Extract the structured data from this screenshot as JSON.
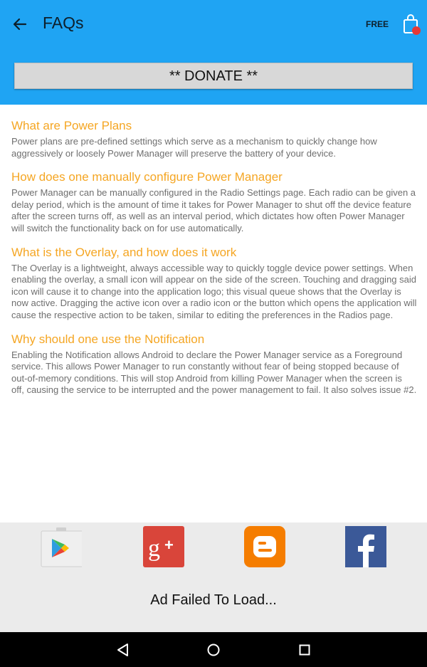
{
  "appbar": {
    "title": "FAQs",
    "free_label": "FREE",
    "back_icon": "arrow-left-icon",
    "cart_icon": "shopping-bag-icon",
    "color": "#1fa4f3"
  },
  "donate": {
    "label": "** DONATE **"
  },
  "faqs": [
    {
      "question": "What are Power Plans",
      "answer": "Power plans are pre-defined settings which serve as a mechanism to quickly change how aggressively or loosely Power Manager will preserve the battery of your device."
    },
    {
      "question": "How does one manually configure Power Manager",
      "answer": "Power Manager can be manually configured in the Radio Settings page. Each radio can be given a delay period, which is the amount of time it takes for Power Manager to shut off the device feature after the screen turns off, as well as an interval period, which dictates how often Power Manager will switch the functionality back on for use automatically."
    },
    {
      "question": "What is the Overlay, and how does it work",
      "answer": "The Overlay is a lightweight, always accessible way to quickly toggle device power settings. When enabling the overlay, a small icon will appear on the side of the screen. Touching and dragging said icon will cause it to change into the application logo; this visual queue shows that the Overlay is now active. Dragging the active icon over a radio icon or the button which opens the application will cause the respective action to be taken, similar to editing the preferences in the Radios page."
    },
    {
      "question": "Why should one use the Notification",
      "answer": "Enabling the Notification allows Android to declare the Power Manager service as a Foreground service. This allows Power Manager to run constantly without fear of being stopped because of out-of-memory conditions. This will stop Android from killing Power Manager when the screen is off, causing the service to be interrupted and the power management to fail. It also solves issue #2."
    }
  ],
  "ad": {
    "message": "Ad Failed To Load...",
    "social_icons": [
      "google-play-icon",
      "google-plus-icon",
      "blogger-icon",
      "facebook-icon"
    ]
  },
  "accent_color": "#f5a623",
  "navbar": {
    "icons": [
      "back-triangle-icon",
      "home-circle-icon",
      "recents-square-icon"
    ]
  }
}
